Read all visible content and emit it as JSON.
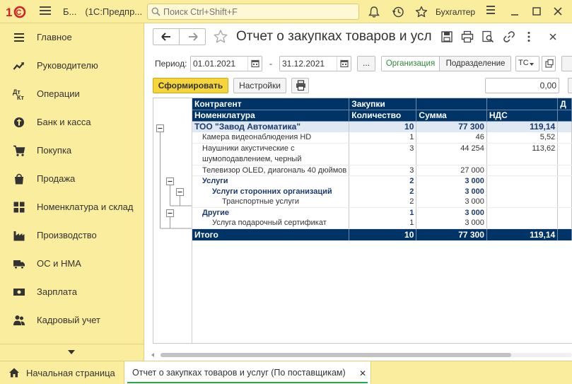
{
  "topbar": {
    "app_short": "Б...",
    "app_title": "(1С:Предпр...",
    "search_placeholder": "Поиск Ctrl+Shift+F",
    "user": "Бухгалтер"
  },
  "sidebar": {
    "items": [
      {
        "label": "Главное",
        "icon": "menu-lines-icon"
      },
      {
        "label": "Руководителю",
        "icon": "trend-chart-icon"
      },
      {
        "label": "Операции",
        "icon": "debit-credit-icon"
      },
      {
        "label": "Банк и касса",
        "icon": "coins-icon"
      },
      {
        "label": "Покупка",
        "icon": "cart-icon"
      },
      {
        "label": "Продажа",
        "icon": "shopping-bag-icon"
      },
      {
        "label": "Номенклатура и склад",
        "icon": "grid-icon"
      },
      {
        "label": "Производство",
        "icon": "factory-icon"
      },
      {
        "label": "ОС и НМА",
        "icon": "truck-icon"
      },
      {
        "label": "Зарплата",
        "icon": "money-icon"
      },
      {
        "label": "Кадровый учет",
        "icon": "people-icon"
      }
    ]
  },
  "report": {
    "title": "Отчет о закупках товаров и усл...",
    "period_label": "Период:",
    "date_from": "01.01.2021",
    "date_to": "31.12.2021",
    "dash": "-",
    "ellipsis": "...",
    "seg_active": "Организация",
    "seg_other": "Подразделение",
    "select_value": "ТС",
    "generate": "Сформировать",
    "settings": "Настройки",
    "amount": "0,00"
  },
  "table": {
    "header1": [
      "Контрагент",
      "Закупки",
      "",
      "",
      "Д"
    ],
    "header2": [
      "Номенклатура",
      "Количество",
      "Сумма",
      "НДС",
      ""
    ],
    "rows": [
      {
        "kind": "grp1",
        "indent": 0,
        "name": "ТОО \"Завод Автоматика\"",
        "qty": "10",
        "sum": "77 300",
        "vat": "119,14"
      },
      {
        "kind": "det",
        "indent": 1,
        "name": "Камера видеонаблюдения HD",
        "qty": "1",
        "sum": "46",
        "vat": "5,52"
      },
      {
        "kind": "det tall",
        "indent": 1,
        "name": "Наушники акустические с шумоподавлением, черный",
        "qty": "3",
        "sum": "44 254",
        "vat": "113,62"
      },
      {
        "kind": "det",
        "indent": 1,
        "name": "Телевизор OLED, диагональ 40 дюймов",
        "qty": "3",
        "sum": "27 000",
        "vat": ""
      },
      {
        "kind": "grp2",
        "indent": 1,
        "name": "Услуги",
        "qty": "2",
        "sum": "3 000",
        "vat": ""
      },
      {
        "kind": "grp2",
        "indent": 2,
        "name": "Услуги сторонних организаций",
        "qty": "2",
        "sum": "3 000",
        "vat": ""
      },
      {
        "kind": "det",
        "indent": 3,
        "name": "Транспортные услуги",
        "qty": "2",
        "sum": "3 000",
        "vat": ""
      },
      {
        "kind": "grp2",
        "indent": 1,
        "name": "Другие",
        "qty": "1",
        "sum": "3 000",
        "vat": ""
      },
      {
        "kind": "det",
        "indent": 2,
        "name": "Услуга подарочный сертификат",
        "qty": "1",
        "sum": "3 000",
        "vat": ""
      }
    ],
    "total": {
      "name": "Итого",
      "qty": "10",
      "sum": "77 300",
      "vat": "119,14"
    }
  },
  "tabs": {
    "home": "Начальная страница",
    "report": "Отчет о закупках товаров и услуг (По поставщикам)",
    "close": "✕"
  }
}
